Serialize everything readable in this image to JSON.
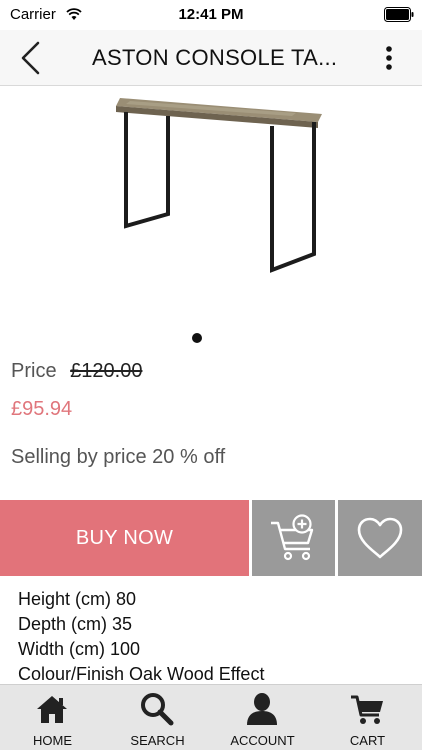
{
  "status_bar": {
    "carrier": "Carrier",
    "time": "12:41 PM"
  },
  "navbar": {
    "title": "ASTON CONSOLE TA...",
    "back_icon": "chevron-left-icon",
    "menu_icon": "vertical-dots-icon"
  },
  "product": {
    "image": "console-table-image",
    "carousel": {
      "current_page": 1,
      "total_pages": 1
    }
  },
  "pricing": {
    "price_label": "Price",
    "original_price": "£120.00",
    "sale_price": "£95.94",
    "discount_text": "Selling by price 20 % off"
  },
  "actions": {
    "buy_now": "BUY NOW",
    "add_to_cart_icon": "cart-plus-icon",
    "wishlist_icon": "heart-icon"
  },
  "specs": [
    "Height (cm) 80",
    "Depth (cm) 35",
    "Width (cm) 100",
    "Colour/Finish Oak Wood Effect"
  ],
  "tabbar": [
    {
      "label": "HOME",
      "icon": "home-icon"
    },
    {
      "label": "SEARCH",
      "icon": "search-icon"
    },
    {
      "label": "ACCOUNT",
      "icon": "account-icon"
    },
    {
      "label": "CART",
      "icon": "cart-icon"
    }
  ],
  "colors": {
    "accent": "#e2737a",
    "sale_price": "#e0767c",
    "secondary_button": "#9a9a9a",
    "tabbar_bg": "#e6e6e6"
  }
}
